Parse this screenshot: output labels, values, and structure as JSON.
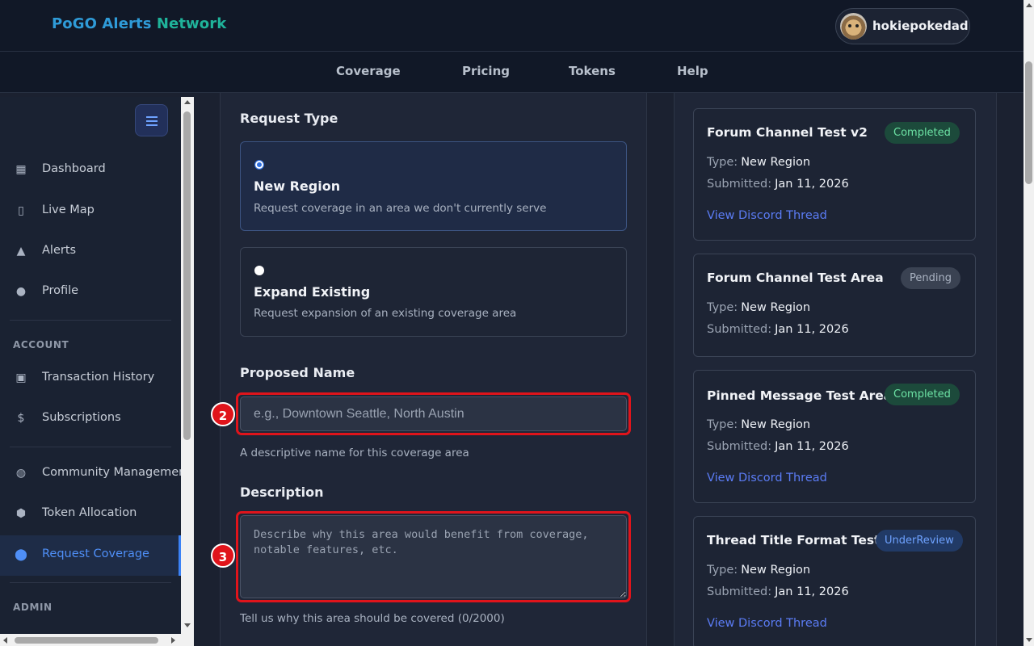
{
  "brand": {
    "part1": "PoGO Alerts ",
    "part2": "Network"
  },
  "user": {
    "name": "hokiepokedad"
  },
  "nav": [
    "Coverage",
    "Pricing",
    "Tokens",
    "Help"
  ],
  "sidebar": {
    "main_items": [
      {
        "label": "Dashboard",
        "icon": "dashboard-icon"
      },
      {
        "label": "Live Map",
        "icon": "map-icon"
      },
      {
        "label": "Alerts",
        "icon": "bell-icon"
      },
      {
        "label": "Profile",
        "icon": "user-icon"
      }
    ],
    "account_heading": "ACCOUNT",
    "account_items": [
      {
        "label": "Transaction History",
        "icon": "payments-icon"
      },
      {
        "label": "Subscriptions",
        "icon": "dollar-icon"
      }
    ],
    "other_items": [
      {
        "label": "Community Management",
        "icon": "globe-icon"
      },
      {
        "label": "Token Allocation",
        "icon": "token-icon"
      },
      {
        "label": "Request Coverage",
        "icon": "location-pin-icon",
        "active": true
      }
    ],
    "admin_heading": "ADMIN"
  },
  "form": {
    "request_type_label": "Request Type",
    "options": [
      {
        "title": "New Region",
        "desc": "Request coverage in an area we don't currently serve",
        "selected": true
      },
      {
        "title": "Expand Existing",
        "desc": "Request expansion of an existing coverage area",
        "selected": false
      }
    ],
    "name_label": "Proposed Name",
    "name_placeholder": "e.g., Downtown Seattle, North Austin",
    "name_value": "",
    "name_help": "A descriptive name for this coverage area",
    "description_label": "Description",
    "description_placeholder": "Describe why this area would benefit from coverage, notable features, etc.",
    "description_value": "",
    "description_help": "Tell us why this area should be covered (0/2000)",
    "markers": [
      "2",
      "3"
    ]
  },
  "requests": [
    {
      "title": "Forum Channel Test v2",
      "status": "Completed",
      "type_label": "Type:",
      "type": "New Region",
      "submitted_label": "Submitted:",
      "submitted": "Jan 11, 2026",
      "link": "View Discord Thread"
    },
    {
      "title": "Forum Channel Test Area",
      "status": "Pending",
      "type_label": "Type:",
      "type": "New Region",
      "submitted_label": "Submitted:",
      "submitted": "Jan 11, 2026"
    },
    {
      "title": "Pinned Message Test Area",
      "status": "Completed",
      "type_label": "Type:",
      "type": "New Region",
      "submitted_label": "Submitted:",
      "submitted": "Jan 11, 2026",
      "link": "View Discord Thread"
    },
    {
      "title": "Thread Title Format Test",
      "status": "UnderReview",
      "type_label": "Type:",
      "type": "New Region",
      "submitted_label": "Submitted:",
      "submitted": "Jan 11, 2026",
      "link": "View Discord Thread"
    }
  ],
  "colors": {
    "accent": "#3b82f6",
    "completed": "#6de3a5",
    "pending": "#aab3c2",
    "review": "#6ea2ff",
    "highlight": "#e0141b"
  }
}
